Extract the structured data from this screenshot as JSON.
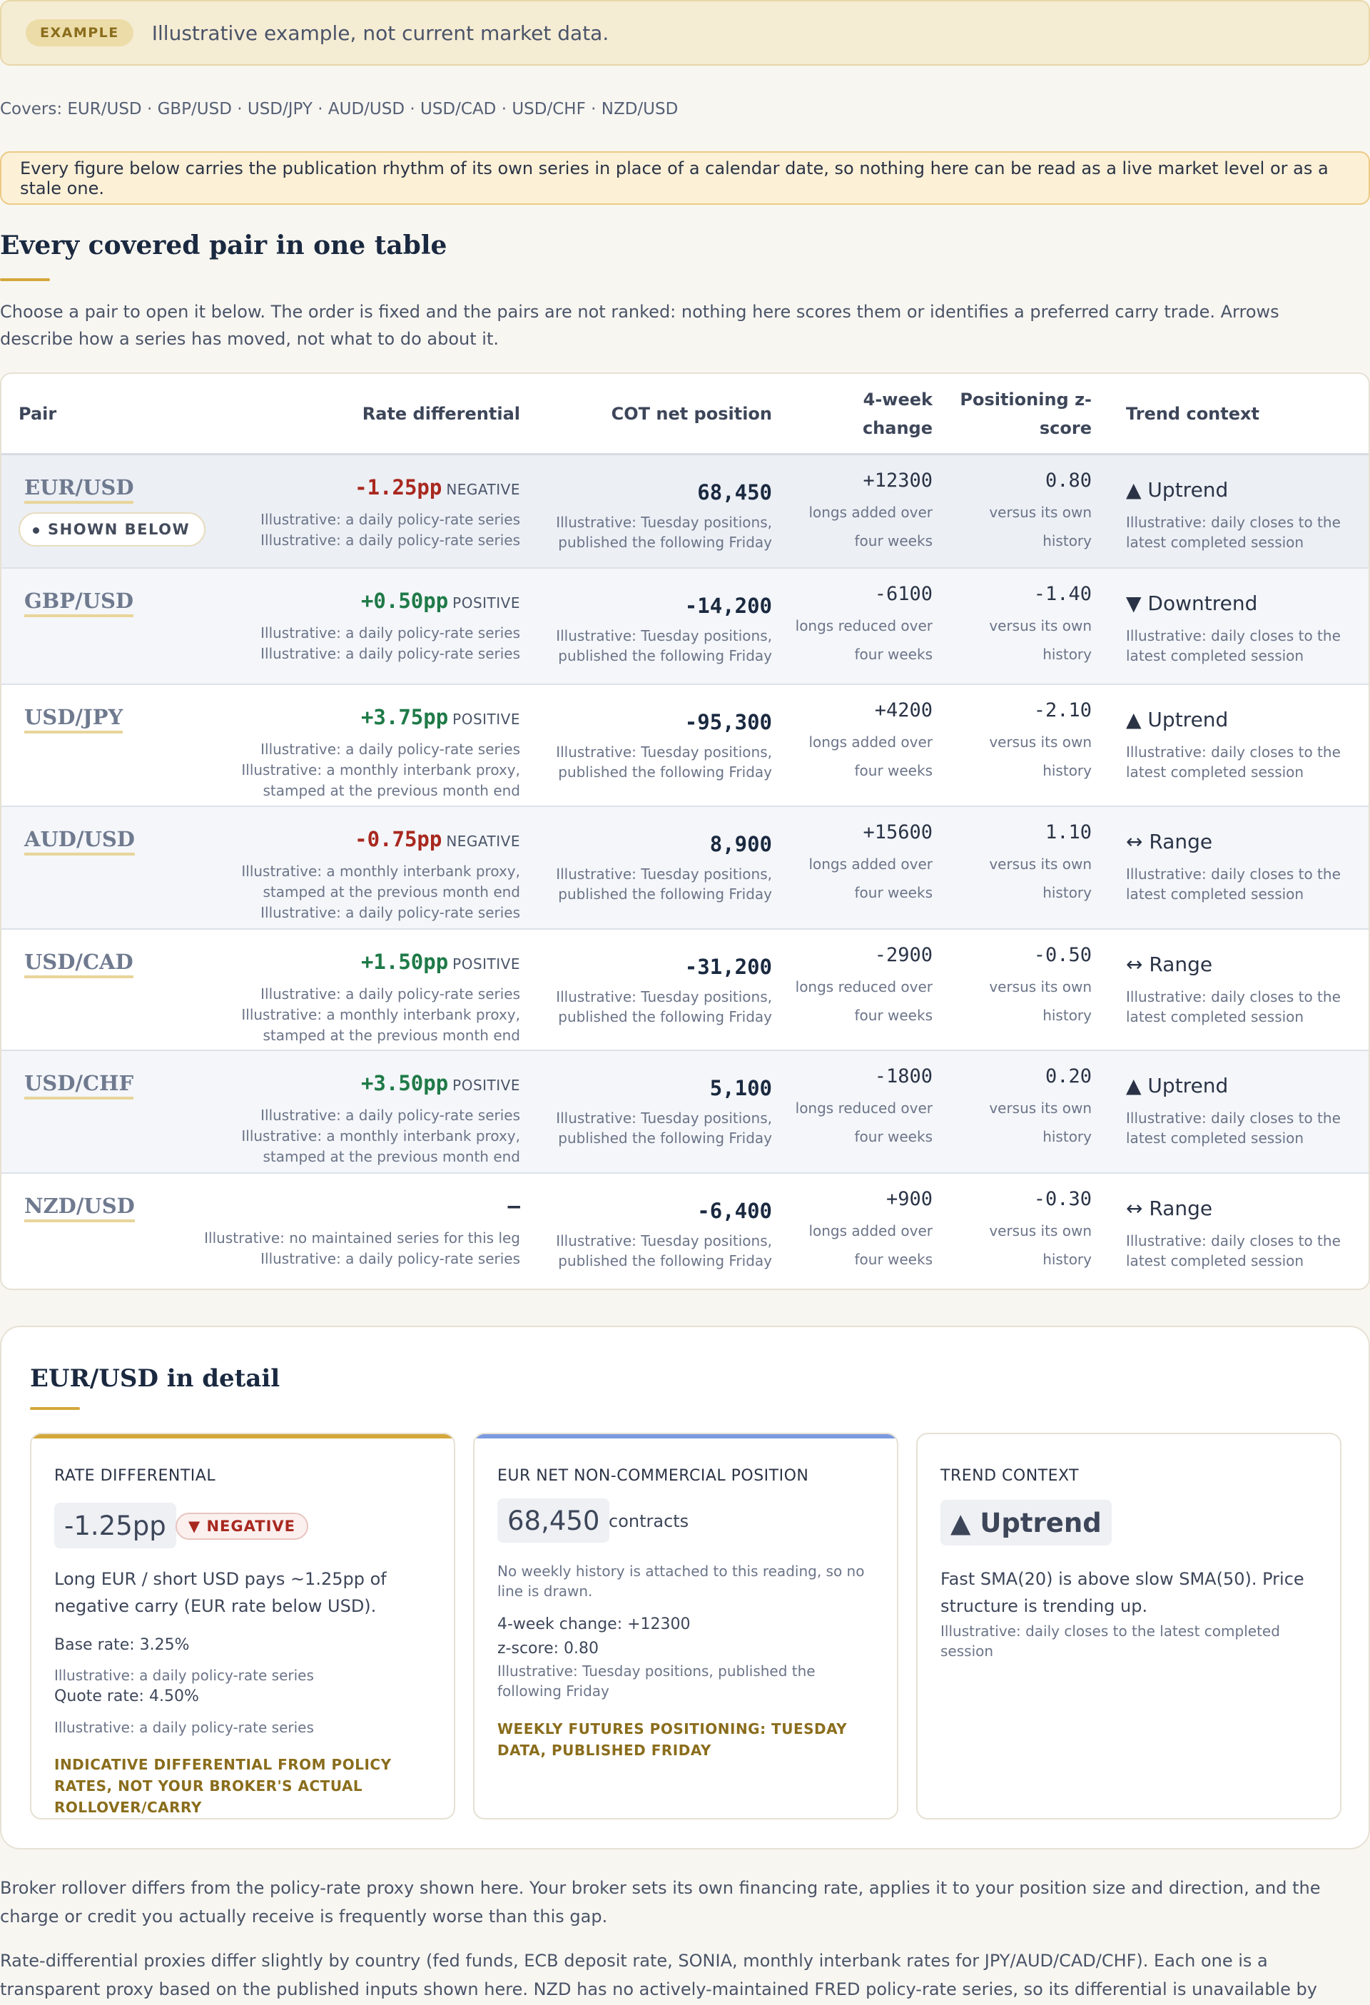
{
  "banner": {
    "badge": "EXAMPLE",
    "text": "Illustrative example, not current market data."
  },
  "covers": "Covers: EUR/USD · GBP/USD · USD/JPY · AUD/USD · USD/CAD · USD/CHF · NZD/USD",
  "notice": "Every figure below carries the publication rhythm of its own series in place of a calendar date, so nothing here can be read as a live market level or as a stale one.",
  "table_section": {
    "title": "Every covered pair in one table",
    "intro": "Choose a pair to open it below. The order is fixed and the pairs are not ranked: nothing here scores them or identifies a preferred carry trade. Arrows describe how a series has moved, not what to do about it.",
    "headers": {
      "pair": "Pair",
      "rate": "Rate differential",
      "cot": "COT net position",
      "change_l1": "4-week",
      "change_l2": "change",
      "z_l1": "Positioning z-",
      "z_l2": "score",
      "trend": "Trend context"
    },
    "shown_below": "SHOWN BELOW",
    "cot_note_1": "Illustrative: Tuesday positions,",
    "cot_note_2": "published the following Friday",
    "z_note_1": "versus its own",
    "z_note_2": "history",
    "trend_note_1": "Illustrative: daily closes to the",
    "trend_note_2": "latest completed session",
    "weeks_note": "four weeks",
    "rows": [
      {
        "pair": "EUR/USD",
        "rate": "-1.25pp",
        "rate_tag": "NEGATIVE",
        "rate_notes": [
          "Illustrative: a daily policy-rate series",
          "Illustrative: a daily policy-rate series"
        ],
        "cot": "68,450",
        "change": "+12300",
        "change_note": "longs added over",
        "z": "0.80",
        "trend": "▲ Uptrend"
      },
      {
        "pair": "GBP/USD",
        "rate": "+0.50pp",
        "rate_tag": "POSITIVE",
        "rate_notes": [
          "Illustrative: a daily policy-rate series",
          "Illustrative: a daily policy-rate series"
        ],
        "cot": "-14,200",
        "change": "-6100",
        "change_note": "longs reduced over",
        "z": "-1.40",
        "trend": "▼ Downtrend"
      },
      {
        "pair": "USD/JPY",
        "rate": "+3.75pp",
        "rate_tag": "POSITIVE",
        "rate_notes": [
          "Illustrative: a daily policy-rate series",
          "Illustrative: a monthly interbank proxy,",
          "stamped at the previous month end"
        ],
        "cot": "-95,300",
        "change": "+4200",
        "change_note": "longs added over",
        "z": "-2.10",
        "trend": "▲ Uptrend"
      },
      {
        "pair": "AUD/USD",
        "rate": "-0.75pp",
        "rate_tag": "NEGATIVE",
        "rate_notes": [
          "Illustrative: a monthly interbank proxy,",
          "stamped at the previous month end",
          "Illustrative: a daily policy-rate series"
        ],
        "cot": "8,900",
        "change": "+15600",
        "change_note": "longs added over",
        "z": "1.10",
        "trend": "↔ Range"
      },
      {
        "pair": "USD/CAD",
        "rate": "+1.50pp",
        "rate_tag": "POSITIVE",
        "rate_notes": [
          "Illustrative: a daily policy-rate series",
          "Illustrative: a monthly interbank proxy,",
          "stamped at the previous month end"
        ],
        "cot": "-31,200",
        "change": "-2900",
        "change_note": "longs reduced over",
        "z": "-0.50",
        "trend": "↔ Range"
      },
      {
        "pair": "USD/CHF",
        "rate": "+3.50pp",
        "rate_tag": "POSITIVE",
        "rate_notes": [
          "Illustrative: a daily policy-rate series",
          "Illustrative: a monthly interbank proxy,",
          "stamped at the previous month end"
        ],
        "cot": "5,100",
        "change": "-1800",
        "change_note": "longs reduced over",
        "z": "0.20",
        "trend": "▲ Uptrend"
      },
      {
        "pair": "NZD/USD",
        "rate": "–",
        "rate_tag": "",
        "rate_notes": [
          "Illustrative: no maintained series for this leg",
          "Illustrative: a daily policy-rate series"
        ],
        "cot": "-6,400",
        "change": "+900",
        "change_note": "longs added over",
        "z": "-0.30",
        "trend": "↔ Range"
      }
    ]
  },
  "detail": {
    "title": "EUR/USD in detail",
    "rate_card": {
      "label": "RATE DIFFERENTIAL",
      "value": "-1.25pp",
      "tag": "▼ NEGATIVE",
      "desc": "Long EUR / short USD pays ~1.25pp of negative carry (EUR rate below USD).",
      "base": "Base rate: 3.25%",
      "base_note": "Illustrative: a daily policy-rate series",
      "quote": "Quote rate: 4.50%",
      "quote_note": "Illustrative: a daily policy-rate series",
      "caption": "INDICATIVE DIFFERENTIAL FROM POLICY RATES, NOT YOUR BROKER'S ACTUAL ROLLOVER/CARRY"
    },
    "cot_card": {
      "label": "EUR NET NON-COMMERCIAL POSITION",
      "value": "68,450",
      "unit": "contracts",
      "history_note": "No weekly history is attached to this reading, so no line is drawn.",
      "change": "4-week change: +12300",
      "z": "z-score: 0.80",
      "note": "Illustrative: Tuesday positions, published the following Friday",
      "caption": "WEEKLY FUTURES POSITIONING: TUESDAY DATA, PUBLISHED FRIDAY"
    },
    "trend_card": {
      "label": "TREND CONTEXT",
      "value": "▲ Uptrend",
      "desc": "Fast SMA(20) is above slow SMA(50). Price structure is trending up.",
      "note": "Illustrative: daily closes to the latest completed session"
    }
  },
  "footer": {
    "p1": "Broker rollover differs from the policy-rate proxy shown here. Your broker sets its own financing rate, applies it to your position size and direction, and the charge or credit you actually receive is frequently worse than this gap.",
    "p2": "Rate-differential proxies differ slightly by country (fed funds, ECB deposit rate, SONIA, monthly interbank rates for JPY/AUD/CAD/CHF). Each one is a transparent proxy based on the published inputs shown here. NZD has no actively-maintained FRED policy-rate series, so its differential is unavailable by design."
  },
  "colors": {
    "negative": "#a8281f",
    "positive": "#1f7a48",
    "accent_gold": "#d4a73b",
    "accent_blue": "#7b9ae0"
  }
}
